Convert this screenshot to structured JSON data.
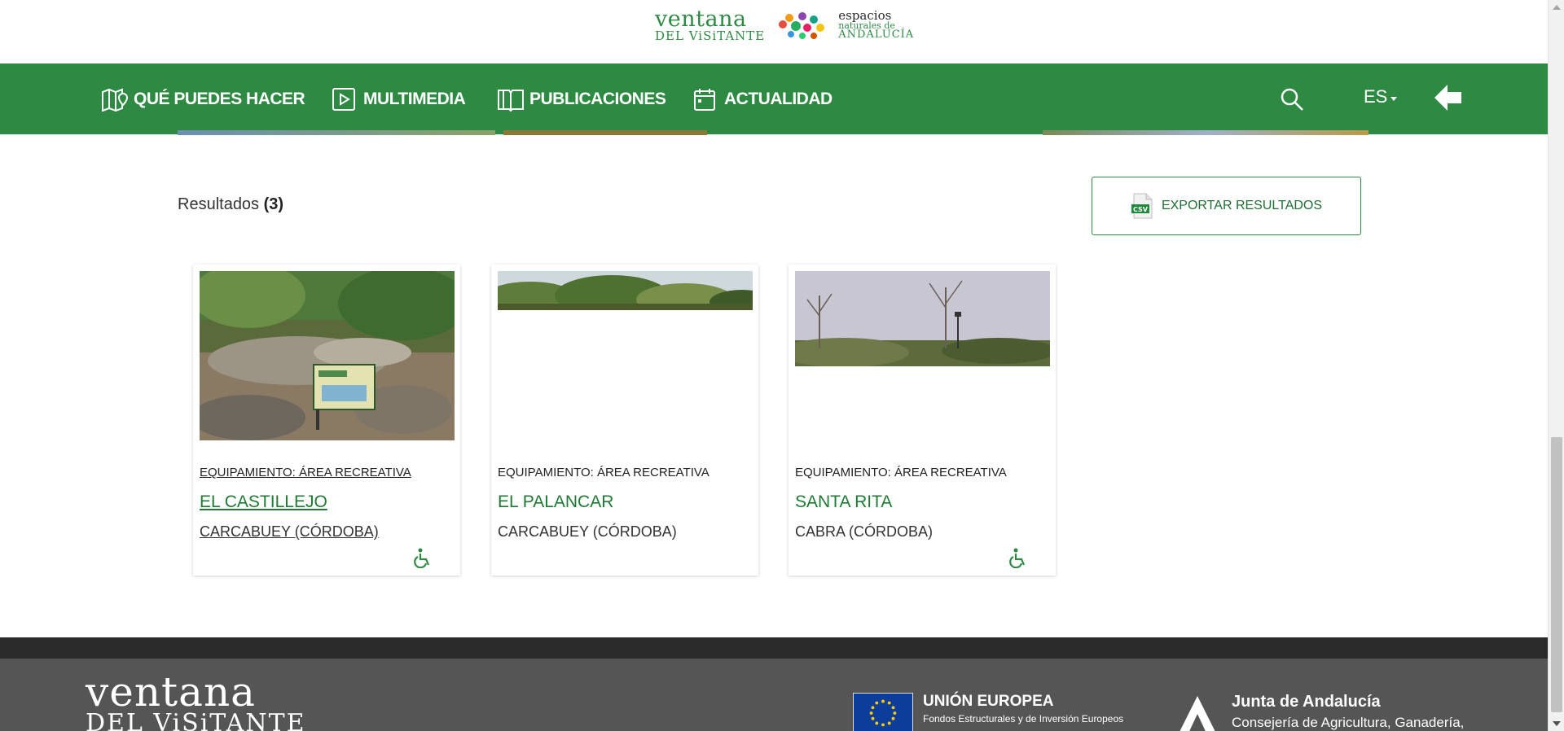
{
  "header": {
    "logo_line1": "ventana",
    "logo_line2": "DEL ViSiTANTE",
    "enp_line1": "espacios",
    "enp_line2": "naturales de",
    "enp_line3": "ANDALUCÍA"
  },
  "nav": {
    "items": [
      {
        "label": "QUÉ PUEDES HACER",
        "icon": "map-icon"
      },
      {
        "label": "MULTIMEDIA",
        "icon": "play-icon"
      },
      {
        "label": "PUBLICACIONES",
        "icon": "book-icon"
      },
      {
        "label": "ACTUALIDAD",
        "icon": "calendar-icon"
      }
    ],
    "language": "ES"
  },
  "results": {
    "label": "Resultados",
    "count": "(3)",
    "export_label": "EXPORTAR RESULTADOS",
    "export_icon_text": "CSV"
  },
  "cards": [
    {
      "category": "EQUIPAMIENTO: ÁREA RECREATIVA",
      "title": "EL CASTILLEJO",
      "location": "CARCABUEY (CÓRDOBA)",
      "accessible": true
    },
    {
      "category": "EQUIPAMIENTO: ÁREA RECREATIVA",
      "title": "EL PALANCAR",
      "location": "CARCABUEY (CÓRDOBA)",
      "accessible": false
    },
    {
      "category": "EQUIPAMIENTO: ÁREA RECREATIVA",
      "title": "SANTA RITA",
      "location": "CABRA (CÓRDOBA)",
      "accessible": true
    }
  ],
  "footer": {
    "logo_line1": "ventana",
    "logo_line2": "DEL ViSiTANTE",
    "eu_title": "UNIÓN EUROPEA",
    "eu_subtitle": "Fondos Estructurales y de Inversión Europeos",
    "junta_title": "Junta de Andalucía",
    "junta_subtitle": "Consejería de Agricultura, Ganadería,"
  },
  "colors": {
    "brand_green": "#2e8a43",
    "title_green": "#1f7a34",
    "footer_gray": "#555555"
  }
}
